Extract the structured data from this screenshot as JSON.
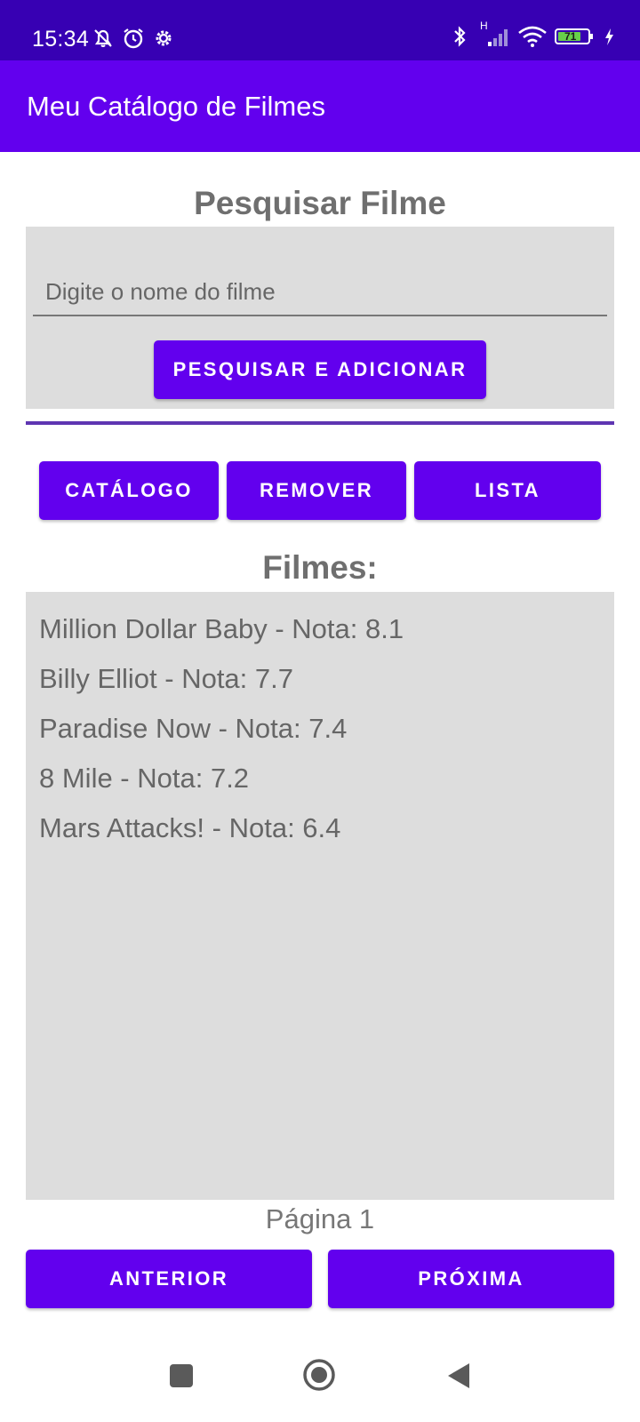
{
  "status_bar": {
    "time": "15:34",
    "battery": "71",
    "network_type": "H"
  },
  "app_bar": {
    "title": "Meu Catálogo de Filmes"
  },
  "search": {
    "title": "Pesquisar Filme",
    "placeholder": "Digite o nome do filme",
    "button_label": "PESQUISAR E ADICIONAR"
  },
  "actions": {
    "catalog_label": "CATÁLOGO",
    "remove_label": "REMOVER",
    "list_label": "LISTA"
  },
  "films": {
    "title": "Filmes:",
    "items": [
      "Million Dollar Baby - Nota: 8.1",
      "Billy Elliot - Nota: 7.7",
      "Paradise Now - Nota: 7.4",
      "8 Mile - Nota: 7.2",
      "Mars Attacks! - Nota: 6.4"
    ]
  },
  "pagination": {
    "page_label": "Página 1",
    "prev_label": "ANTERIOR",
    "next_label": "PRÓXIMA"
  },
  "colors": {
    "status_bar": "#3700b3",
    "primary": "#6200ee",
    "panel": "#dddddd"
  },
  "icons": [
    "bell-off-icon",
    "alarm-icon",
    "settings-icon",
    "bluetooth-icon",
    "signal-icon",
    "wifi-icon",
    "battery-icon",
    "charging-icon",
    "recents-icon",
    "home-icon",
    "back-icon"
  ]
}
